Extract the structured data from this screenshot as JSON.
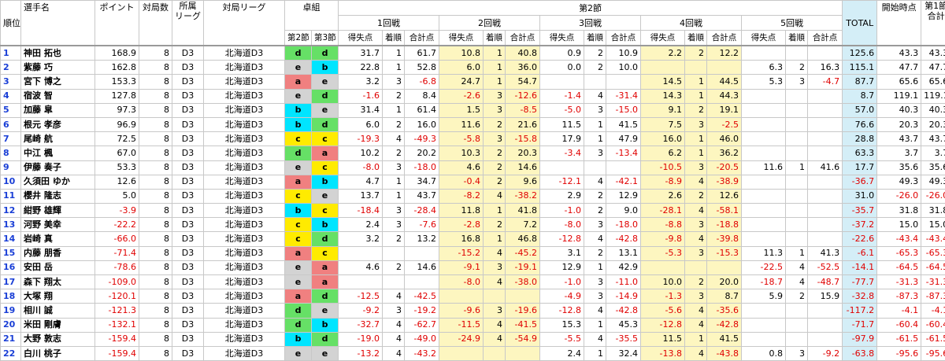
{
  "header": {
    "rank": "順位",
    "name": "選手名",
    "points": "ポイント",
    "games": "対局数",
    "league_top": "所属",
    "league_bot": "リーグ",
    "match_league": "対局リーグ",
    "table_group": "卓組",
    "round2": "第2節",
    "round3": "第3節",
    "section": "第2節",
    "games_labels": [
      "1回戦",
      "2回戦",
      "3回戦",
      "4回戦",
      "5回戦"
    ],
    "sub": [
      "得失点",
      "着順",
      "合計点"
    ],
    "total": "TOTAL",
    "start": "開始時点",
    "first_top": "第1節",
    "first_bot": "合計"
  },
  "rows": [
    {
      "i": "1",
      "n": "神田 拓也",
      "p": "168.9",
      "c": "8",
      "l": "D3",
      "m": "北海道D3",
      "t2": "d",
      "t3": "d",
      "g": [
        [
          "31.7",
          "1",
          "61.7"
        ],
        [
          "10.8",
          "1",
          "40.8"
        ],
        [
          "0.9",
          "2",
          "10.9"
        ],
        [
          "2.2",
          "2",
          "12.2"
        ],
        [
          "",
          "",
          ""
        ]
      ],
      "tot": "125.6",
      "st": "43.3",
      "f": "43.3"
    },
    {
      "i": "2",
      "n": "紫藤 巧",
      "p": "162.8",
      "c": "8",
      "l": "D3",
      "m": "北海道D3",
      "t2": "e",
      "t3": "b",
      "g": [
        [
          "22.8",
          "1",
          "52.8"
        ],
        [
          "6.0",
          "1",
          "36.0"
        ],
        [
          "0.0",
          "2",
          "10.0"
        ],
        [
          "",
          "",
          ""
        ],
        [
          "6.3",
          "2",
          "16.3"
        ]
      ],
      "tot": "115.1",
      "st": "47.7",
      "f": "47.7"
    },
    {
      "i": "3",
      "n": "宮下 博之",
      "p": "153.3",
      "c": "8",
      "l": "D3",
      "m": "北海道D3",
      "t2": "a",
      "t3": "e",
      "g": [
        [
          "3.2",
          "3",
          "-6.8"
        ],
        [
          "24.7",
          "1",
          "54.7"
        ],
        [
          "",
          "",
          ""
        ],
        [
          "14.5",
          "1",
          "44.5"
        ],
        [
          "5.3",
          "3",
          "-4.7"
        ]
      ],
      "tot": "87.7",
      "st": "65.6",
      "f": "65.6"
    },
    {
      "i": "4",
      "n": "宿波 智",
      "p": "127.8",
      "c": "8",
      "l": "D3",
      "m": "北海道D3",
      "t2": "e",
      "t3": "d",
      "g": [
        [
          "-1.6",
          "2",
          "8.4"
        ],
        [
          "-2.6",
          "3",
          "-12.6"
        ],
        [
          "-1.4",
          "4",
          "-31.4"
        ],
        [
          "14.3",
          "1",
          "44.3"
        ],
        [
          "",
          "",
          ""
        ]
      ],
      "tot": "8.7",
      "st": "119.1",
      "f": "119.1"
    },
    {
      "i": "5",
      "n": "加藤 皐",
      "p": "97.3",
      "c": "8",
      "l": "D3",
      "m": "北海道D3",
      "t2": "b",
      "t3": "e",
      "g": [
        [
          "31.4",
          "1",
          "61.4"
        ],
        [
          "1.5",
          "3",
          "-8.5"
        ],
        [
          "-5.0",
          "3",
          "-15.0"
        ],
        [
          "9.1",
          "2",
          "19.1"
        ],
        [
          "",
          "",
          ""
        ]
      ],
      "tot": "57.0",
      "st": "40.3",
      "f": "40.3"
    },
    {
      "i": "6",
      "n": "根元 孝彦",
      "p": "96.9",
      "c": "8",
      "l": "D3",
      "m": "北海道D3",
      "t2": "b",
      "t3": "d",
      "g": [
        [
          "6.0",
          "2",
          "16.0"
        ],
        [
          "11.6",
          "2",
          "21.6"
        ],
        [
          "11.5",
          "1",
          "41.5"
        ],
        [
          "7.5",
          "3",
          "-2.5"
        ],
        [
          "",
          "",
          ""
        ]
      ],
      "tot": "76.6",
      "st": "20.3",
      "f": "20.3"
    },
    {
      "i": "7",
      "n": "尾崎 航",
      "p": "72.5",
      "c": "8",
      "l": "D3",
      "m": "北海道D3",
      "t2": "c",
      "t3": "c",
      "g": [
        [
          "-19.3",
          "4",
          "-49.3"
        ],
        [
          "-5.8",
          "3",
          "-15.8"
        ],
        [
          "17.9",
          "1",
          "47.9"
        ],
        [
          "16.0",
          "1",
          "46.0"
        ],
        [
          "",
          "",
          ""
        ]
      ],
      "tot": "28.8",
      "st": "43.7",
      "f": "43.7"
    },
    {
      "i": "8",
      "n": "中江 楓",
      "p": "67.0",
      "c": "8",
      "l": "D3",
      "m": "北海道D3",
      "t2": "d",
      "t3": "a",
      "g": [
        [
          "10.2",
          "2",
          "20.2"
        ],
        [
          "10.3",
          "2",
          "20.3"
        ],
        [
          "-3.4",
          "3",
          "-13.4"
        ],
        [
          "6.2",
          "1",
          "36.2"
        ],
        [
          "",
          "",
          ""
        ]
      ],
      "tot": "63.3",
      "st": "3.7",
      "f": "3.7"
    },
    {
      "i": "9",
      "n": "伊藤 奏子",
      "p": "53.3",
      "c": "8",
      "l": "D3",
      "m": "北海道D3",
      "t2": "e",
      "t3": "c",
      "g": [
        [
          "-8.0",
          "3",
          "-18.0"
        ],
        [
          "4.6",
          "2",
          "14.6"
        ],
        [
          "",
          "",
          ""
        ],
        [
          "-10.5",
          "3",
          "-20.5"
        ],
        [
          "11.6",
          "1",
          "41.6"
        ]
      ],
      "tot": "17.7",
      "st": "35.6",
      "f": "35.6"
    },
    {
      "i": "10",
      "n": "久須田 ゆか",
      "p": "12.6",
      "c": "8",
      "l": "D3",
      "m": "北海道D3",
      "t2": "a",
      "t3": "b",
      "g": [
        [
          "4.7",
          "1",
          "34.7"
        ],
        [
          "-0.4",
          "2",
          "9.6"
        ],
        [
          "-12.1",
          "4",
          "-42.1"
        ],
        [
          "-8.9",
          "4",
          "-38.9"
        ],
        [
          "",
          "",
          ""
        ]
      ],
      "tot": "-36.7",
      "st": "49.3",
      "f": "49.3"
    },
    {
      "i": "11",
      "n": "櫻井 隆志",
      "p": "5.0",
      "c": "8",
      "l": "D3",
      "m": "北海道D3",
      "t2": "c",
      "t3": "e",
      "g": [
        [
          "13.7",
          "1",
          "43.7"
        ],
        [
          "-8.2",
          "4",
          "-38.2"
        ],
        [
          "2.9",
          "2",
          "12.9"
        ],
        [
          "2.6",
          "2",
          "12.6"
        ],
        [
          "",
          "",
          ""
        ]
      ],
      "tot": "31.0",
      "st": "-26.0",
      "f": "-26.0"
    },
    {
      "i": "12",
      "n": "紺野 雄輝",
      "p": "-3.9",
      "c": "8",
      "l": "D3",
      "m": "北海道D3",
      "t2": "b",
      "t3": "c",
      "g": [
        [
          "-18.4",
          "3",
          "-28.4"
        ],
        [
          "11.8",
          "1",
          "41.8"
        ],
        [
          "-1.0",
          "2",
          "9.0"
        ],
        [
          "-28.1",
          "4",
          "-58.1"
        ],
        [
          "",
          "",
          ""
        ]
      ],
      "tot": "-35.7",
      "st": "31.8",
      "f": "31.8"
    },
    {
      "i": "13",
      "n": "河野 美幸",
      "p": "-22.2",
      "c": "8",
      "l": "D3",
      "m": "北海道D3",
      "t2": "c",
      "t3": "b",
      "g": [
        [
          "2.4",
          "3",
          "-7.6"
        ],
        [
          "-2.8",
          "2",
          "7.2"
        ],
        [
          "-8.0",
          "3",
          "-18.0"
        ],
        [
          "-8.8",
          "3",
          "-18.8"
        ],
        [
          "",
          "",
          ""
        ]
      ],
      "tot": "-37.2",
      "st": "15.0",
      "f": "15.0"
    },
    {
      "i": "14",
      "n": "岩崎 真",
      "p": "-66.0",
      "c": "8",
      "l": "D3",
      "m": "北海道D3",
      "t2": "c",
      "t3": "d",
      "g": [
        [
          "3.2",
          "2",
          "13.2"
        ],
        [
          "16.8",
          "1",
          "46.8"
        ],
        [
          "-12.8",
          "4",
          "-42.8"
        ],
        [
          "-9.8",
          "4",
          "-39.8"
        ],
        [
          "",
          "",
          ""
        ]
      ],
      "tot": "-22.6",
      "st": "-43.4",
      "f": "-43.4"
    },
    {
      "i": "15",
      "n": "内藤 朋香",
      "p": "-71.4",
      "c": "8",
      "l": "D3",
      "m": "北海道D3",
      "t2": "a",
      "t3": "c",
      "g": [
        [
          "",
          "",
          ""
        ],
        [
          "-15.2",
          "4",
          "-45.2"
        ],
        [
          "3.1",
          "2",
          "13.1"
        ],
        [
          "-5.3",
          "3",
          "-15.3"
        ],
        [
          "11.3",
          "1",
          "41.3"
        ]
      ],
      "tot": "-6.1",
      "st": "-65.3",
      "f": "-65.3"
    },
    {
      "i": "16",
      "n": "安田 岳",
      "p": "-78.6",
      "c": "8",
      "l": "D3",
      "m": "北海道D3",
      "t2": "e",
      "t3": "a",
      "g": [
        [
          "4.6",
          "2",
          "14.6"
        ],
        [
          "-9.1",
          "3",
          "-19.1"
        ],
        [
          "12.9",
          "1",
          "42.9"
        ],
        [
          "",
          "",
          ""
        ],
        [
          "-22.5",
          "4",
          "-52.5"
        ]
      ],
      "tot": "-14.1",
      "st": "-64.5",
      "f": "-64.5"
    },
    {
      "i": "17",
      "n": "森下 翔太",
      "p": "-109.0",
      "c": "8",
      "l": "D3",
      "m": "北海道D3",
      "t2": "e",
      "t3": "a",
      "g": [
        [
          "",
          "",
          ""
        ],
        [
          "-8.0",
          "4",
          "-38.0"
        ],
        [
          "-1.0",
          "3",
          "-11.0"
        ],
        [
          "10.0",
          "2",
          "20.0"
        ],
        [
          "-18.7",
          "4",
          "-48.7"
        ]
      ],
      "tot": "-77.7",
      "st": "-31.3",
      "f": "-31.3"
    },
    {
      "i": "18",
      "n": "大塚 翔",
      "p": "-120.1",
      "c": "8",
      "l": "D3",
      "m": "北海道D3",
      "t2": "a",
      "t3": "d",
      "g": [
        [
          "-12.5",
          "4",
          "-42.5"
        ],
        [
          "",
          "",
          ""
        ],
        [
          "-4.9",
          "3",
          "-14.9"
        ],
        [
          "-1.3",
          "3",
          "8.7"
        ],
        [
          "5.9",
          "2",
          "15.9"
        ]
      ],
      "tot": "-32.8",
      "st": "-87.3",
      "f": "-87.3"
    },
    {
      "i": "19",
      "n": "相川 誠",
      "p": "-121.3",
      "c": "8",
      "l": "D3",
      "m": "北海道D3",
      "t2": "d",
      "t3": "e",
      "g": [
        [
          "-9.2",
          "3",
          "-19.2"
        ],
        [
          "-9.6",
          "3",
          "-19.6"
        ],
        [
          "-12.8",
          "4",
          "-42.8"
        ],
        [
          "-5.6",
          "4",
          "-35.6"
        ],
        [
          "",
          "",
          ""
        ]
      ],
      "tot": "-117.2",
      "st": "-4.1",
      "f": "-4.1"
    },
    {
      "i": "20",
      "n": "米田 剛膚",
      "p": "-132.1",
      "c": "8",
      "l": "D3",
      "m": "北海道D3",
      "t2": "d",
      "t3": "b",
      "g": [
        [
          "-32.7",
          "4",
          "-62.7"
        ],
        [
          "-11.5",
          "4",
          "-41.5"
        ],
        [
          "15.3",
          "1",
          "45.3"
        ],
        [
          "-12.8",
          "4",
          "-42.8"
        ],
        [
          "",
          "",
          ""
        ]
      ],
      "tot": "-71.7",
      "st": "-60.4",
      "f": "-60.4"
    },
    {
      "i": "21",
      "n": "大野 敦志",
      "p": "-159.4",
      "c": "8",
      "l": "D3",
      "m": "北海道D3",
      "t2": "b",
      "t3": "d",
      "g": [
        [
          "-19.0",
          "4",
          "-49.0"
        ],
        [
          "-24.9",
          "4",
          "-54.9"
        ],
        [
          "-5.5",
          "4",
          "-35.5"
        ],
        [
          "11.5",
          "1",
          "41.5"
        ],
        [
          "",
          "",
          ""
        ]
      ],
      "tot": "-97.9",
      "st": "-61.5",
      "f": "-61.5"
    },
    {
      "i": "22",
      "n": "白川 桃子",
      "p": "-159.4",
      "c": "8",
      "l": "D3",
      "m": "北海道D3",
      "t2": "e",
      "t3": "e",
      "g": [
        [
          "-13.2",
          "4",
          "-43.2"
        ],
        [
          "",
          "",
          ""
        ],
        [
          "2.4",
          "1",
          "32.4"
        ],
        [
          "-13.8",
          "4",
          "-43.8"
        ],
        [
          "0.8",
          "3",
          "-9.2"
        ]
      ],
      "tot": "-63.8",
      "st": "-95.6",
      "f": "-95.6"
    }
  ]
}
